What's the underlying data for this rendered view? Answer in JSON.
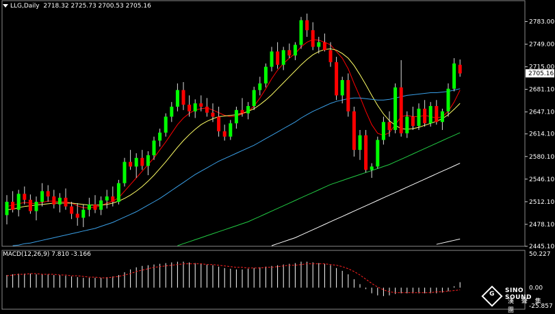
{
  "header": {
    "symbol": "LLG,Daily",
    "ohlc": "2718.32 2725.73 2700.53 2705.16",
    "indicator": "MACD(12,26,9) 7.810 -3.166"
  },
  "watermark": {
    "brand": "SINO SOUND",
    "chinese": "漢 聲 集 團"
  },
  "colors": {
    "background": "#000000",
    "bull": "#00ff00",
    "bear": "#ff0000",
    "ma_fast": "#ff0000",
    "ma_mid": "#ffff66",
    "ma_blue": "#3aa0e8",
    "ma_green": "#22cc44",
    "ma_white": "#ffffff",
    "signal": "#ff2020",
    "hist": "#ffffff"
  },
  "chart_data": [
    {
      "type": "candlestick",
      "title": "LLG,Daily",
      "ylim": [
        2445.1,
        2800
      ],
      "y_ticks": [
        2783.0,
        2749.0,
        2715.0,
        2681.1,
        2647.1,
        2614.1,
        2580.1,
        2546.1,
        2512.1,
        2478.1,
        2445.1
      ],
      "last_price": "2705.16",
      "candles_ohlc": [
        [
          2492,
          2522,
          2478,
          2512
        ],
        [
          2512,
          2528,
          2496,
          2500
        ],
        [
          2500,
          2530,
          2490,
          2524
        ],
        [
          2524,
          2535,
          2508,
          2515
        ],
        [
          2515,
          2523,
          2494,
          2498
        ],
        [
          2498,
          2520,
          2484,
          2512
        ],
        [
          2512,
          2540,
          2505,
          2528
        ],
        [
          2528,
          2537,
          2512,
          2520
        ],
        [
          2520,
          2530,
          2502,
          2508
        ],
        [
          2508,
          2525,
          2496,
          2518
        ],
        [
          2518,
          2532,
          2500,
          2505
        ],
        [
          2505,
          2512,
          2486,
          2494
        ],
        [
          2494,
          2510,
          2476,
          2488
        ],
        [
          2488,
          2508,
          2474,
          2500
        ],
        [
          2500,
          2518,
          2490,
          2508
        ],
        [
          2508,
          2522,
          2495,
          2500
        ],
        [
          2500,
          2520,
          2492,
          2514
        ],
        [
          2514,
          2530,
          2502,
          2520
        ],
        [
          2520,
          2535,
          2505,
          2512
        ],
        [
          2512,
          2545,
          2508,
          2540
        ],
        [
          2540,
          2578,
          2535,
          2572
        ],
        [
          2572,
          2590,
          2560,
          2565
        ],
        [
          2565,
          2585,
          2548,
          2578
        ],
        [
          2578,
          2590,
          2560,
          2566
        ],
        [
          2566,
          2588,
          2552,
          2582
        ],
        [
          2582,
          2610,
          2575,
          2604
        ],
        [
          2604,
          2622,
          2595,
          2616
        ],
        [
          2616,
          2645,
          2610,
          2640
        ],
        [
          2640,
          2662,
          2632,
          2655
        ],
        [
          2655,
          2690,
          2648,
          2680
        ],
        [
          2680,
          2692,
          2650,
          2658
        ],
        [
          2658,
          2672,
          2640,
          2648
        ],
        [
          2648,
          2666,
          2638,
          2660
        ],
        [
          2660,
          2672,
          2648,
          2655
        ],
        [
          2655,
          2668,
          2640,
          2646
        ],
        [
          2646,
          2660,
          2632,
          2640
        ],
        [
          2640,
          2655,
          2610,
          2618
        ],
        [
          2618,
          2628,
          2604,
          2610
        ],
        [
          2610,
          2635,
          2605,
          2630
        ],
        [
          2630,
          2655,
          2622,
          2650
        ],
        [
          2650,
          2668,
          2640,
          2645
        ],
        [
          2645,
          2662,
          2636,
          2656
        ],
        [
          2656,
          2685,
          2650,
          2680
        ],
        [
          2680,
          2700,
          2672,
          2690
        ],
        [
          2690,
          2720,
          2684,
          2715
        ],
        [
          2715,
          2745,
          2708,
          2738
        ],
        [
          2738,
          2752,
          2712,
          2718
        ],
        [
          2718,
          2745,
          2710,
          2740
        ],
        [
          2740,
          2750,
          2728,
          2732
        ],
        [
          2732,
          2752,
          2725,
          2748
        ],
        [
          2748,
          2790,
          2742,
          2785
        ],
        [
          2785,
          2795,
          2760,
          2770
        ],
        [
          2770,
          2782,
          2740,
          2745
        ],
        [
          2745,
          2760,
          2735,
          2752
        ],
        [
          2752,
          2765,
          2738,
          2740
        ],
        [
          2740,
          2752,
          2715,
          2722
        ],
        [
          2722,
          2730,
          2665,
          2672
        ],
        [
          2672,
          2700,
          2660,
          2695
        ],
        [
          2695,
          2705,
          2640,
          2648
        ],
        [
          2648,
          2655,
          2580,
          2590
        ],
        [
          2590,
          2620,
          2575,
          2612
        ],
        [
          2612,
          2620,
          2556,
          2560
        ],
        [
          2560,
          2570,
          2548,
          2565
        ],
        [
          2565,
          2610,
          2562,
          2605
        ],
        [
          2605,
          2640,
          2598,
          2632
        ],
        [
          2632,
          2648,
          2610,
          2620
        ],
        [
          2620,
          2690,
          2615,
          2684
        ],
        [
          2684,
          2725,
          2610,
          2615
        ],
        [
          2615,
          2648,
          2608,
          2640
        ],
        [
          2640,
          2655,
          2620,
          2626
        ],
        [
          2626,
          2660,
          2620,
          2652
        ],
        [
          2652,
          2665,
          2625,
          2630
        ],
        [
          2630,
          2662,
          2625,
          2656
        ],
        [
          2656,
          2665,
          2628,
          2632
        ],
        [
          2632,
          2652,
          2620,
          2648
        ],
        [
          2648,
          2690,
          2640,
          2682
        ],
        [
          2682,
          2728,
          2678,
          2720
        ],
        [
          2718,
          2726,
          2700,
          2705
        ]
      ],
      "moving_averages": [
        {
          "color": "#ff0000",
          "values": [
            2505,
            2507,
            2509,
            2511,
            2510,
            2509,
            2511,
            2513,
            2513,
            2512,
            2512,
            2510,
            2506,
            2503,
            2503,
            2504,
            2506,
            2510,
            2513,
            2518,
            2528,
            2538,
            2548,
            2558,
            2568,
            2578,
            2590,
            2602,
            2615,
            2628,
            2638,
            2645,
            2650,
            2652,
            2653,
            2650,
            2646,
            2642,
            2640,
            2641,
            2644,
            2648,
            2656,
            2668,
            2682,
            2697,
            2710,
            2720,
            2728,
            2735,
            2745,
            2752,
            2756,
            2755,
            2752,
            2748,
            2738,
            2728,
            2712,
            2690,
            2670,
            2648,
            2628,
            2615,
            2612,
            2616,
            2628,
            2640,
            2642,
            2640,
            2640,
            2642,
            2640,
            2638,
            2640,
            2648,
            2662,
            2680
          ]
        },
        {
          "color": "#ffff66",
          "values": [
            2500,
            2501,
            2503,
            2505,
            2506,
            2507,
            2508,
            2509,
            2510,
            2510,
            2510,
            2510,
            2509,
            2508,
            2507,
            2507,
            2507,
            2508,
            2510,
            2513,
            2517,
            2522,
            2528,
            2535,
            2543,
            2552,
            2562,
            2572,
            2583,
            2594,
            2604,
            2613,
            2621,
            2628,
            2633,
            2637,
            2640,
            2641,
            2642,
            2643,
            2645,
            2648,
            2652,
            2658,
            2665,
            2673,
            2682,
            2691,
            2700,
            2709,
            2718,
            2726,
            2733,
            2738,
            2741,
            2742,
            2740,
            2735,
            2728,
            2717,
            2703,
            2688,
            2672,
            2657,
            2644,
            2634,
            2627,
            2622,
            2621,
            2622,
            2624,
            2627,
            2630,
            2633,
            2637,
            2643,
            2651,
            2660
          ]
        },
        {
          "color": "#3aa0e8",
          "values": [
            2445,
            2446,
            2447,
            2449,
            2450,
            2452,
            2454,
            2456,
            2458,
            2460,
            2462,
            2464,
            2466,
            2468,
            2470,
            2472,
            2475,
            2478,
            2481,
            2485,
            2489,
            2493,
            2497,
            2502,
            2507,
            2512,
            2517,
            2523,
            2529,
            2535,
            2541,
            2547,
            2553,
            2558,
            2563,
            2568,
            2573,
            2577,
            2581,
            2585,
            2589,
            2593,
            2597,
            2602,
            2607,
            2612,
            2617,
            2622,
            2627,
            2632,
            2638,
            2643,
            2648,
            2652,
            2656,
            2660,
            2663,
            2665,
            2667,
            2668,
            2668,
            2667,
            2666,
            2665,
            2665,
            2666,
            2668,
            2670,
            2672,
            2673,
            2674,
            2675,
            2676,
            2676,
            2677,
            2678,
            2680,
            2682
          ]
        },
        {
          "color": "#22cc44",
          "values": [
            2400,
            2401,
            2402,
            2403,
            2404,
            2405,
            2406,
            2407,
            2408,
            2409,
            2410,
            2411,
            2412,
            2413,
            2414,
            2415,
            2417,
            2419,
            2421,
            2423,
            2425,
            2427,
            2429,
            2431,
            2433,
            2435,
            2437,
            2440,
            2443,
            2446,
            2449,
            2452,
            2455,
            2458,
            2461,
            2464,
            2467,
            2470,
            2473,
            2476,
            2479,
            2482,
            2486,
            2490,
            2494,
            2498,
            2502,
            2506,
            2510,
            2514,
            2518,
            2522,
            2526,
            2530,
            2534,
            2538,
            2541,
            2544,
            2547,
            2550,
            2553,
            2556,
            2559,
            2562,
            2565,
            2568,
            2572,
            2576,
            2580,
            2584,
            2588,
            2592,
            2596,
            2600,
            2604,
            2608,
            2612,
            2616
          ]
        },
        {
          "color": "#ffffff",
          "values": [
            2380,
            2381,
            2382,
            2383,
            2384,
            2385,
            2386,
            2387,
            2388,
            2389,
            2390,
            2391,
            2392,
            2393,
            2394,
            2395,
            2396,
            2397,
            2398,
            2399,
            2400,
            2401,
            2402,
            2403,
            2404,
            2405,
            2406,
            2407,
            2408,
            2410,
            2412,
            2414,
            2416,
            2418,
            2420,
            2422,
            2424,
            2426,
            2428,
            2430,
            2432,
            2434,
            2437,
            2440,
            2443,
            2446,
            2449,
            2452,
            2455,
            2458,
            2462,
            2466,
            2470,
            2474,
            2478,
            2482,
            2486,
            2490,
            2494,
            2498,
            2502,
            2506,
            2510,
            2514,
            2518,
            2522,
            2526,
            2530,
            2534,
            2538,
            2542,
            2546,
            2550,
            2554,
            2558,
            2562,
            2566,
            2570
          ]
        },
        {
          "color": "#ffffff",
          "values": [
            null,
            null,
            null,
            null,
            null,
            null,
            null,
            null,
            null,
            null,
            null,
            null,
            null,
            null,
            null,
            null,
            null,
            null,
            null,
            null,
            null,
            null,
            null,
            null,
            null,
            null,
            null,
            null,
            null,
            null,
            null,
            null,
            null,
            null,
            null,
            null,
            null,
            null,
            null,
            null,
            null,
            null,
            null,
            null,
            null,
            null,
            null,
            null,
            null,
            null,
            null,
            null,
            null,
            null,
            null,
            null,
            null,
            null,
            null,
            null,
            null,
            null,
            null,
            null,
            null,
            null,
            null,
            null,
            null,
            null,
            null,
            null,
            null,
            2448,
            2450,
            2452,
            2454,
            2456
          ]
        }
      ]
    },
    {
      "type": "macd",
      "title": "MACD(12,26,9) 7.810 -3.166",
      "ylim": [
        -25.857,
        50.227
      ],
      "y_ticks": [
        50.227,
        0.0,
        -25.857
      ],
      "histogram": [
        18,
        19,
        20,
        20,
        20,
        19,
        19,
        19,
        18,
        18,
        17,
        16,
        15,
        14,
        14,
        14,
        14,
        15,
        16,
        18,
        22,
        26,
        29,
        31,
        32,
        33,
        34,
        35,
        36,
        37,
        37,
        36,
        35,
        34,
        33,
        32,
        30,
        28,
        27,
        26,
        26,
        27,
        28,
        29,
        30,
        31,
        32,
        33,
        34,
        35,
        37,
        37,
        36,
        35,
        34,
        32,
        28,
        24,
        19,
        12,
        5,
        -2,
        -8,
        -11,
        -12,
        -11,
        -9,
        -8,
        -8,
        -8,
        -8,
        -8,
        -8,
        -8,
        -7,
        -5,
        2,
        7.81
      ],
      "signal": [
        17,
        18,
        19,
        19,
        20,
        20,
        19,
        19,
        19,
        18,
        18,
        17,
        17,
        16,
        15,
        15,
        14,
        14,
        15,
        16,
        18,
        20,
        23,
        25,
        27,
        29,
        30,
        31,
        32,
        33,
        34,
        34,
        34,
        34,
        33,
        33,
        32,
        31,
        30,
        29,
        29,
        28,
        28,
        28,
        29,
        29,
        30,
        31,
        32,
        32,
        33,
        34,
        34,
        34,
        34,
        33,
        32,
        30,
        27,
        23,
        18,
        12,
        6,
        1,
        -3,
        -6,
        -7,
        -7,
        -7,
        -7,
        -7,
        -7,
        -7,
        -6,
        -6,
        -5,
        -4,
        -3.166
      ]
    }
  ]
}
